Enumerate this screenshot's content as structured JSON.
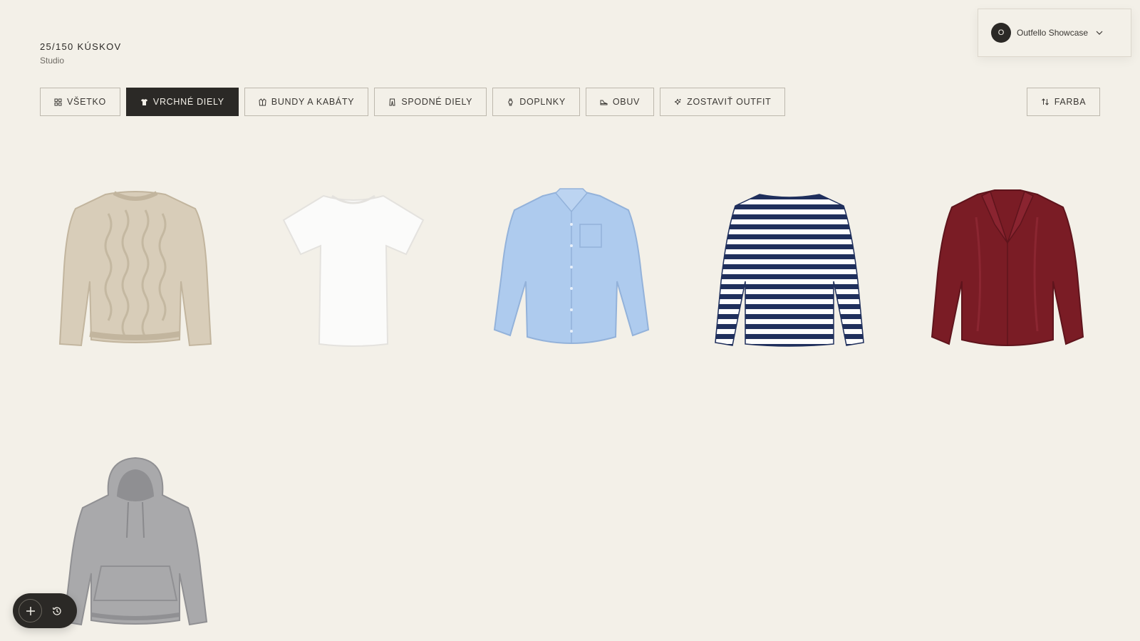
{
  "header": {
    "counter": "25/150 KÚSKOV",
    "subtitle": "Studio"
  },
  "account": {
    "avatar_letter": "O",
    "name": "Outfello Showcase",
    "chevron_icon": "chevron-down-icon"
  },
  "filters": {
    "all": {
      "label": "VŠETKO",
      "icon": "grid-icon"
    },
    "tops": {
      "label": "VRCHNÉ DIELY",
      "icon": "tshirt-icon",
      "active": true
    },
    "jackets": {
      "label": "BUNDY A KABÁTY",
      "icon": "jacket-icon"
    },
    "bottoms": {
      "label": "SPODNÉ DIELY",
      "icon": "trousers-icon"
    },
    "accessories": {
      "label": "DOPLNKY",
      "icon": "watch-icon"
    },
    "shoes": {
      "label": "OBUV",
      "icon": "shoe-icon"
    },
    "build_outfit": {
      "label": "ZOSTAVIŤ OUTFIT",
      "icon": "sparkle-icon"
    }
  },
  "sort": {
    "label": "FARBA",
    "icon": "sort-arrows-icon"
  },
  "items": [
    {
      "kind": "cable-knit-sweater",
      "color": "#d8cdb9"
    },
    {
      "kind": "t-shirt",
      "color": "#fbfbfa"
    },
    {
      "kind": "oxford-shirt",
      "color": "#aecbee"
    },
    {
      "kind": "striped-long-sleeve",
      "color": "#1f2f5c"
    },
    {
      "kind": "satin-blouse",
      "color": "#7a1c25"
    },
    {
      "kind": "hoodie",
      "color": "#a9a9ab"
    }
  ],
  "fab": {
    "add_icon": "plus-icon",
    "history_icon": "history-icon"
  },
  "colors": {
    "background": "#f3f0e8",
    "accent": "#2b2926"
  }
}
